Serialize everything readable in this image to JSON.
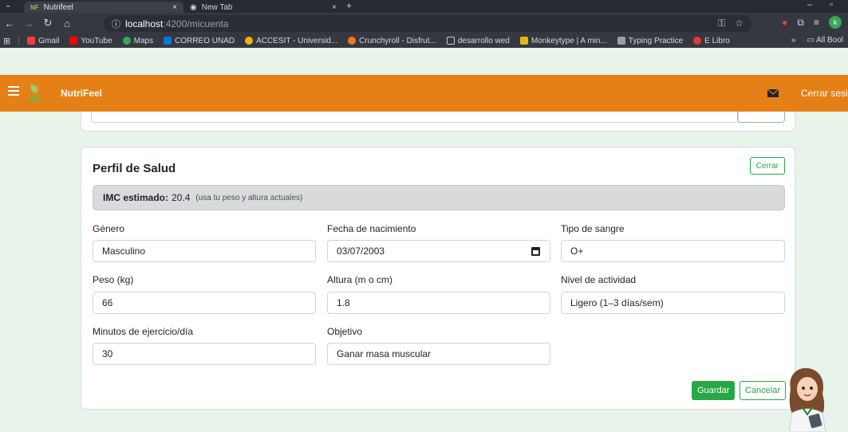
{
  "browser": {
    "tabs": [
      {
        "title": "Nutrifeel",
        "close": "×"
      },
      {
        "title": "New Tab",
        "close": "×"
      }
    ],
    "new_tab": "+",
    "address": {
      "host": "localhost",
      "path": ":4200/micuenta"
    },
    "bookmarks": [
      {
        "label": "Gmail",
        "color": "#ea4335"
      },
      {
        "label": "YouTube",
        "color": "#ff0000"
      },
      {
        "label": "Maps",
        "color": "#34a853"
      },
      {
        "label": "CORREO UNAD",
        "color": "#0078d4"
      },
      {
        "label": "ACCESIT - Universid...",
        "color": "#f4b400"
      },
      {
        "label": "Crunchyroll - Disfrut...",
        "color": "#f47521"
      },
      {
        "label": "desarrollo wed",
        "color": "#9aa0a6"
      },
      {
        "label": "Monkeytype | A min...",
        "color": "#e2b714"
      },
      {
        "label": "Typing Practice",
        "color": "#9aa0a6"
      },
      {
        "label": "E Libro",
        "color": "#e53935"
      }
    ],
    "bookmarks_more": "»",
    "all_bookmarks": "All Bool",
    "profile_initial": "k"
  },
  "app": {
    "brand": "NutriFeel",
    "logo_text": "NF",
    "logout": "Cerrar sesi",
    "accent_color": "#e58017"
  },
  "profile": {
    "title": "Perfil de Salud",
    "close_label": "Cerrar",
    "imc": {
      "label": "IMC estimado:",
      "value": "20.4",
      "note": "(usa tu peso y altura actuales)"
    },
    "fields": {
      "gender": {
        "label": "Género",
        "value": "Masculino"
      },
      "birthdate": {
        "label": "Fecha de nacimiento",
        "value": "03/07/2003"
      },
      "blood": {
        "label": "Tipo de sangre",
        "value": "O+"
      },
      "weight": {
        "label": "Peso (kg)",
        "value": "66"
      },
      "height": {
        "label": "Altura (m o cm)",
        "value": "1.8"
      },
      "activity": {
        "label": "Nivel de actividad",
        "value": "Ligero (1–3 días/sem)"
      },
      "exercise": {
        "label": "Minutos de ejercicio/día",
        "value": "30"
      },
      "goal": {
        "label": "Objetivo",
        "value": "Ganar masa muscular"
      }
    },
    "save_label": "Guardar",
    "cancel_label": "Cancelar"
  }
}
